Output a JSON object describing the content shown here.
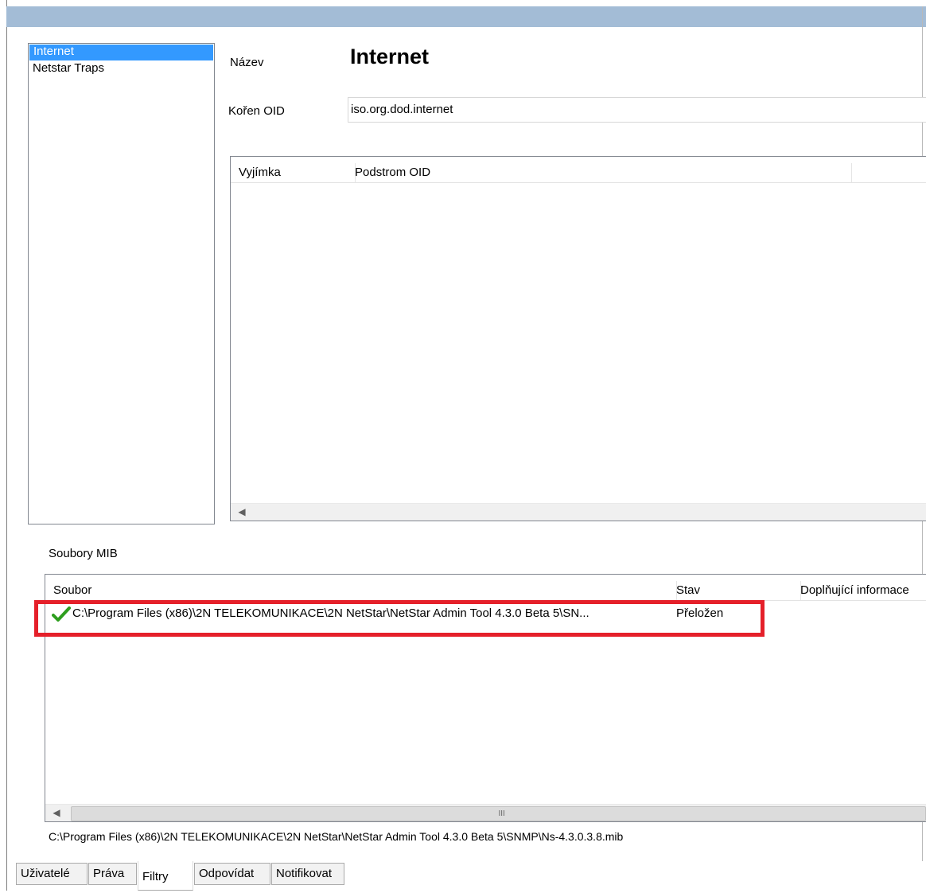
{
  "filters_list": {
    "items": [
      {
        "label": "Internet",
        "selected": true
      },
      {
        "label": "Netstar Traps",
        "selected": false
      }
    ]
  },
  "detail": {
    "name_label": "Název",
    "name_value": "Internet",
    "oid_label": "Kořen OID",
    "oid_value": "iso.org.dod.internet"
  },
  "exceptions_grid": {
    "columns": [
      "Vyjímka",
      "Podstrom OID"
    ],
    "rows": []
  },
  "mib": {
    "section_label": "Soubory MIB",
    "columns": [
      "Soubor",
      "Stav",
      "Doplňující informace"
    ],
    "rows": [
      {
        "status_icon": "green-checkmark-icon",
        "file": "C:\\Program Files (x86)\\2N TELEKOMUNIKACE\\2N NetStar\\NetStar Admin Tool 4.3.0 Beta 5\\SN...",
        "state": "Přeložen",
        "info": ""
      }
    ],
    "highlight_color": "#e5202a",
    "scroll_thumb_grip": "III",
    "full_path": "C:\\Program Files (x86)\\2N TELEKOMUNIKACE\\2N NetStar\\NetStar Admin Tool 4.3.0 Beta 5\\SNMP\\Ns-4.3.0.3.8.mib"
  },
  "tabs": [
    {
      "label": "Uživatelé",
      "active": false
    },
    {
      "label": "Práva",
      "active": false
    },
    {
      "label": "Filtry",
      "active": true
    },
    {
      "label": "Odpovídat",
      "active": false
    },
    {
      "label": "Notifikovat",
      "active": false
    }
  ],
  "colors": {
    "titlebar": "#a3bcd6",
    "selection": "#3399ff",
    "check": "#2e9e1e"
  }
}
